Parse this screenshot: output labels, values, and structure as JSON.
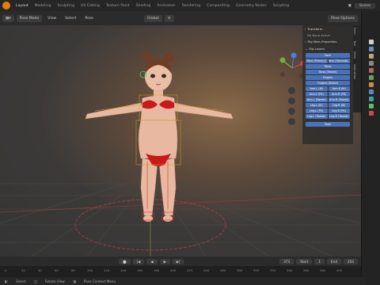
{
  "topbar": {
    "tabs": [
      "Layout",
      "Modeling",
      "Sculpting",
      "UV Editing",
      "Texture Paint",
      "Shading",
      "Animation",
      "Rendering",
      "Compositing",
      "Geometry Nodes",
      "Scripting"
    ],
    "active_tab": 0,
    "scene": "Scene"
  },
  "header": {
    "mode": "Pose Mode",
    "view": "View",
    "select": "Select",
    "pose": "Pose",
    "orientation": "Global",
    "pose_options": "Pose Options"
  },
  "npanel": {
    "transform_label": "Transform",
    "no_bone_text": "No Bone Active",
    "rig_props_label": "Rig Main Properties",
    "rig_layers_label": "Rig Layers",
    "buttons": {
      "face": "Face",
      "face_primary": "Face (Primary)",
      "face_secondary": "Face (Seconda...",
      "torso": "Torso",
      "torso_tweak": "Torso (Tweak)",
      "fingers": "Fingers",
      "fingers_detail": "Fingers (Detail)",
      "arm_l_ik": "Arm.L (IK)",
      "arm_r_ik": "Arm.R (IK)",
      "arm_l_fk": "Arm.L (FK)",
      "arm_r_fk": "Arm.R (FK)",
      "arm_l_tweak": "Arm.L (Tweak)",
      "arm_r_tweak": "Arm.R (Tweak)",
      "leg_l_ik": "Leg.L (IK)",
      "leg_r_ik": "Leg.R (IK)",
      "leg_l_fk": "Leg.L (FK)",
      "leg_r_fk": "Leg.R (FK)",
      "leg_l_tweak": "Leg.L (Tweak)",
      "leg_r_tweak": "Leg.R (Tweak)",
      "root": "Root"
    }
  },
  "side_tabs": [
    "Item",
    "Tool",
    "View",
    "Animation"
  ],
  "timeline": {
    "frame_current": "373",
    "start_label": "Start",
    "start_value": "1",
    "end_label": "End",
    "end_value": "250"
  },
  "ruler_ticks": [
    "0",
    "20",
    "40",
    "60",
    "80",
    "100",
    "120",
    "140",
    "160",
    "180",
    "200",
    "220",
    "240",
    "260",
    "280",
    "300",
    "320",
    "340",
    "360",
    "380",
    "400"
  ],
  "statusbar": {
    "select": "Select",
    "rotate": "Rotate View",
    "context": "Pose Context Menu"
  },
  "colors": {
    "accent_blue": "#4a72b8",
    "blender_orange": "#e87d0d",
    "bikini_red": "#c91a1a",
    "skin": "#e8b9a0"
  }
}
